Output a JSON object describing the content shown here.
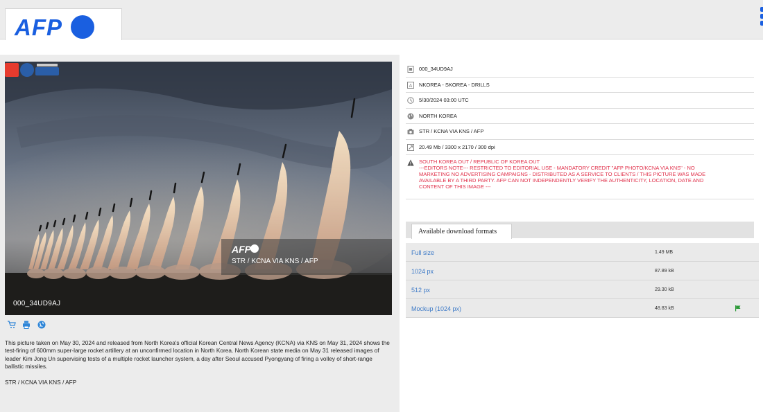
{
  "brand": {
    "logo_text": "AFP",
    "color": "#1a5fe0"
  },
  "photo": {
    "id_label": "000_34UD9AJ",
    "overlay_logo": "AFP",
    "overlay_credit": "STR / KCNA VIA KNS / AFP"
  },
  "actions": [
    {
      "icon": "cart-icon"
    },
    {
      "icon": "print-icon"
    },
    {
      "icon": "globe-icon"
    }
  ],
  "caption": {
    "text": "This picture taken on May 30, 2024 and released from North Korea's official Korean Central News Agency (KCNA) via KNS on May 31, 2024 shows the test-firing of 600mm super-large rocket artillery at an unconfirmed location in North Korea. North Korean state media on May 31 released images of leader Kim Jong Un supervising tests of a multiple rocket launcher system, a day after Seoul accused Pyongyang of firing a volley of short-range ballistic missiles.",
    "credit": "STR / KCNA VIA KNS / AFP"
  },
  "metadata": {
    "id": "000_34UD9AJ",
    "headline": "NKOREA - SKOREA - DRILLS",
    "datetime": "5/30/2024 03:00 UTC",
    "location": "NORTH KOREA",
    "credit": "STR / KCNA VIA KNS / AFP",
    "file_info": "20.49 Mb / 3300 x 2170 / 300 dpi",
    "restrictions": "SOUTH KOREA OUT / REPUBLIC OF KOREA OUT\n---EDITORS NOTE--- RESTRICTED TO EDITORIAL USE - MANDATORY CREDIT \"AFP PHOTO/KCNA VIA KNS\" - NO MARKETING NO ADVERTISING CAMPAIGNS - DISTRIBUTED AS A SERVICE TO CLIENTS / THIS PICTURE WAS MADE AVAILABLE BY A THIRD PARTY. AFP CAN NOT INDEPENDENTLY VERIFY THE AUTHENTICITY, LOCATION, DATE AND CONTENT OF THIS IMAGE ---",
    "warning_color": "#e0304a"
  },
  "downloads": {
    "tab_label": "Available download formats",
    "link_color": "#3d7ac7",
    "rows": [
      {
        "name": "Full size",
        "size": "1.49 MB"
      },
      {
        "name": "1024 px",
        "size": "87.89 kB"
      },
      {
        "name": "512 px",
        "size": "29.30 kB"
      },
      {
        "name": "Mockup (1024 px)",
        "size": "48.83 kB",
        "icon": "flag-icon"
      }
    ]
  }
}
